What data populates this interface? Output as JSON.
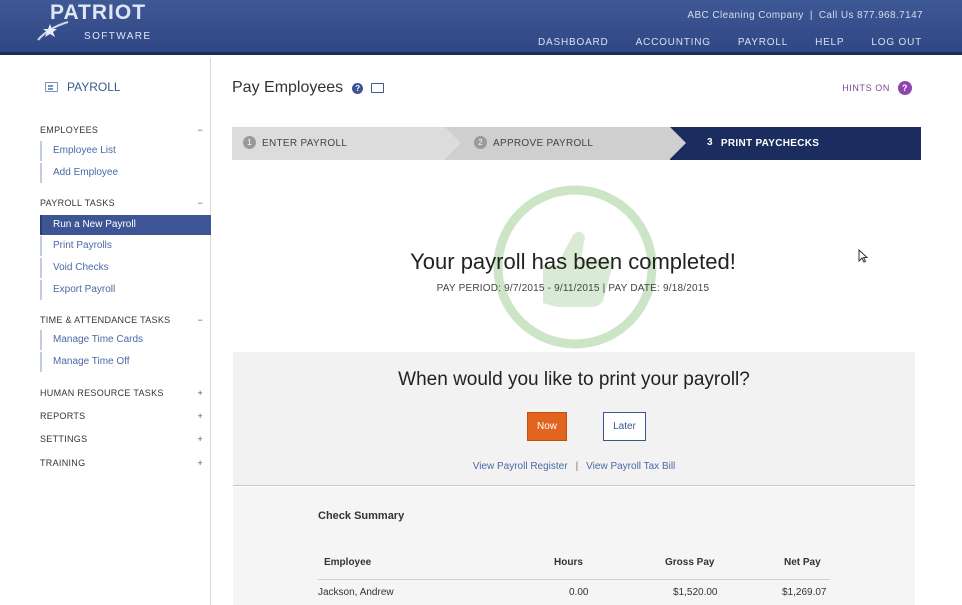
{
  "brand": {
    "name": "PATRIOT",
    "sub": "SOFTWARE"
  },
  "top_info": {
    "company": "ABC Cleaning Company",
    "separator": "|",
    "phone": "Call Us 877.968.7147"
  },
  "top_nav": [
    "DASHBOARD",
    "ACCOUNTING",
    "PAYROLL",
    "HELP",
    "LOG OUT"
  ],
  "sidebar": {
    "title": "PAYROLL",
    "sections": [
      {
        "label": "EMPLOYEES",
        "toggle": "−",
        "items": [
          "Employee List",
          "Add Employee"
        ]
      },
      {
        "label": "PAYROLL TASKS",
        "toggle": "−",
        "items": [
          "Run a New Payroll",
          "Print Payrolls",
          "Void Checks",
          "Export Payroll"
        ]
      },
      {
        "label": "TIME & ATTENDANCE TASKS",
        "toggle": "−",
        "items": [
          "Manage Time Cards",
          "Manage Time Off"
        ]
      },
      {
        "label": "HUMAN RESOURCE TASKS",
        "toggle": "+"
      },
      {
        "label": "REPORTS",
        "toggle": "+"
      },
      {
        "label": "SETTINGS",
        "toggle": "+"
      },
      {
        "label": "TRAINING",
        "toggle": "+"
      }
    ]
  },
  "page": {
    "title": "Pay Employees",
    "help_glyph": "?",
    "hints_label": "HINTS ON",
    "hints_glyph": "?"
  },
  "steps": [
    {
      "num": "1",
      "label": "ENTER PAYROLL"
    },
    {
      "num": "2",
      "label": "APPROVE PAYROLL"
    },
    {
      "num": "3",
      "label": "PRINT PAYCHECKS"
    }
  ],
  "completion": {
    "headline": "Your payroll has been completed!",
    "period": "PAY PERIOD: 9/7/2015 - 9/11/2015 | PAY DATE: 9/18/2015"
  },
  "print": {
    "question": "When would you like to print your payroll?",
    "now": "Now",
    "later": "Later",
    "link_register": "View Payroll Register",
    "link_sep": "|",
    "link_tax": "View Payroll Tax Bill"
  },
  "check_summary": {
    "title": "Check Summary",
    "columns": [
      "Employee",
      "Hours",
      "Gross Pay",
      "Net Pay"
    ],
    "rows": [
      {
        "employee": "Jackson, Andrew",
        "hours": "0.00",
        "gross": "$1,520.00",
        "net": "$1,269.07"
      }
    ]
  },
  "colors": {
    "header_bg": "#34508c",
    "accent": "#3d5594",
    "active_step": "#1b2c5e",
    "now_button": "#e0631e",
    "hints": "#8e44ad",
    "watermark": "#9fd09a"
  }
}
